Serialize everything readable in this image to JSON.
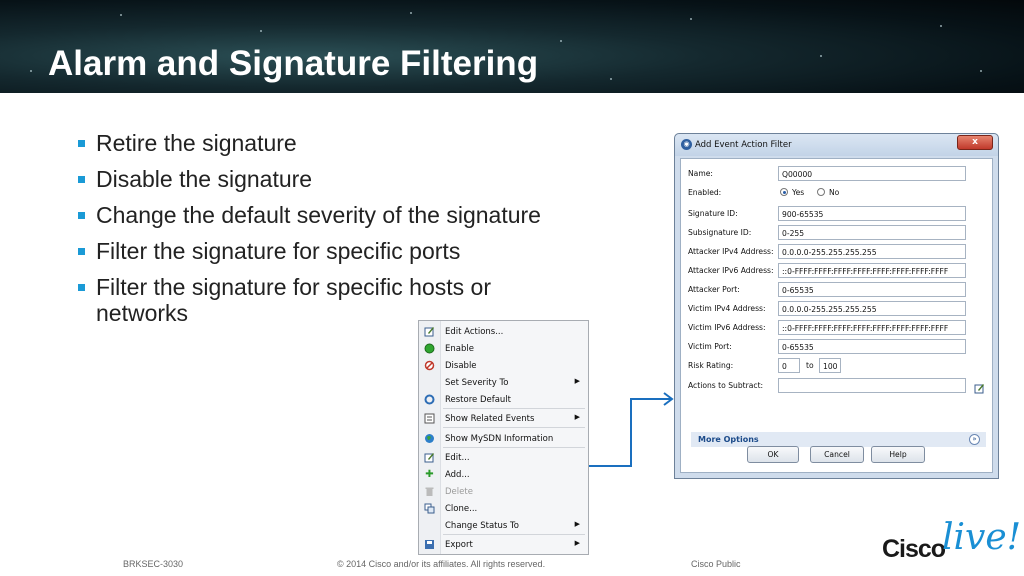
{
  "slide": {
    "title": "Alarm and Signature Filtering",
    "bullets": [
      "Retire the signature",
      "Disable the signature",
      "Change the default severity of the signature",
      "Filter the signature for specific ports",
      "Filter the signature for specific hosts or networks"
    ],
    "bullet_color": "#1a9ad6"
  },
  "context_menu": {
    "items": [
      {
        "label": "Edit Actions...",
        "icon": "edit-actions-icon",
        "submenu": false,
        "enabled": true
      },
      {
        "label": "Enable",
        "icon": "enable-icon",
        "submenu": false,
        "enabled": true
      },
      {
        "label": "Disable",
        "icon": "disable-icon",
        "submenu": false,
        "enabled": true
      },
      {
        "label": "Set Severity To",
        "icon": "",
        "submenu": true,
        "enabled": true
      },
      {
        "label": "Restore Default",
        "icon": "restore-icon",
        "submenu": false,
        "enabled": true
      },
      {
        "label": "Show Related Events",
        "icon": "events-icon",
        "submenu": true,
        "enabled": true
      },
      {
        "label": "Show MySDN Information",
        "icon": "globe-icon",
        "submenu": false,
        "enabled": true
      },
      {
        "label": "Edit...",
        "icon": "edit-icon",
        "submenu": false,
        "enabled": true
      },
      {
        "label": "Add...",
        "icon": "add-icon",
        "submenu": false,
        "enabled": true
      },
      {
        "label": "Delete",
        "icon": "trash-icon",
        "submenu": false,
        "enabled": false
      },
      {
        "label": "Clone...",
        "icon": "clone-icon",
        "submenu": false,
        "enabled": true
      },
      {
        "label": "Change Status To",
        "icon": "",
        "submenu": true,
        "enabled": true
      },
      {
        "label": "Export",
        "icon": "save-icon",
        "submenu": true,
        "enabled": true
      }
    ]
  },
  "dialog": {
    "title": "Add Event Action Filter",
    "close_label": "x",
    "fields": [
      {
        "label": "Name:",
        "value": "Q00000"
      },
      {
        "label": "Enabled:",
        "radio": [
          "Yes",
          "No"
        ],
        "selected": "Yes"
      },
      {
        "label": "Signature ID:",
        "value": "900-65535"
      },
      {
        "label": "Subsignature ID:",
        "value": "0-255"
      },
      {
        "label": "Attacker IPv4 Address:",
        "value": "0.0.0.0-255.255.255.255"
      },
      {
        "label": "Attacker IPv6 Address:",
        "value": "::0-FFFF:FFFF:FFFF:FFFF:FFFF:FFFF:FFFF:FFFF"
      },
      {
        "label": "Attacker Port:",
        "value": "0-65535"
      },
      {
        "label": "Victim IPv4 Address:",
        "value": "0.0.0.0-255.255.255.255"
      },
      {
        "label": "Victim IPv6 Address:",
        "value": "::0-FFFF:FFFF:FFFF:FFFF:FFFF:FFFF:FFFF:FFFF"
      },
      {
        "label": "Victim Port:",
        "value": "0-65535"
      },
      {
        "label": "Risk Rating:",
        "from": "0",
        "to_label": "to",
        "to": "100"
      },
      {
        "label": "Actions to Subtract:",
        "value": ""
      }
    ],
    "more_options": "More Options",
    "buttons": {
      "ok": "OK",
      "cancel": "Cancel",
      "help": "Help"
    }
  },
  "footer": {
    "session": "BRKSEC-3030",
    "copyright": "© 2014 Cisco and/or its affiliates. All rights reserved.",
    "classification": "Cisco Public"
  },
  "logo": {
    "word": "Cisco",
    "script": "live!",
    "accent": "#1a8fd4"
  }
}
